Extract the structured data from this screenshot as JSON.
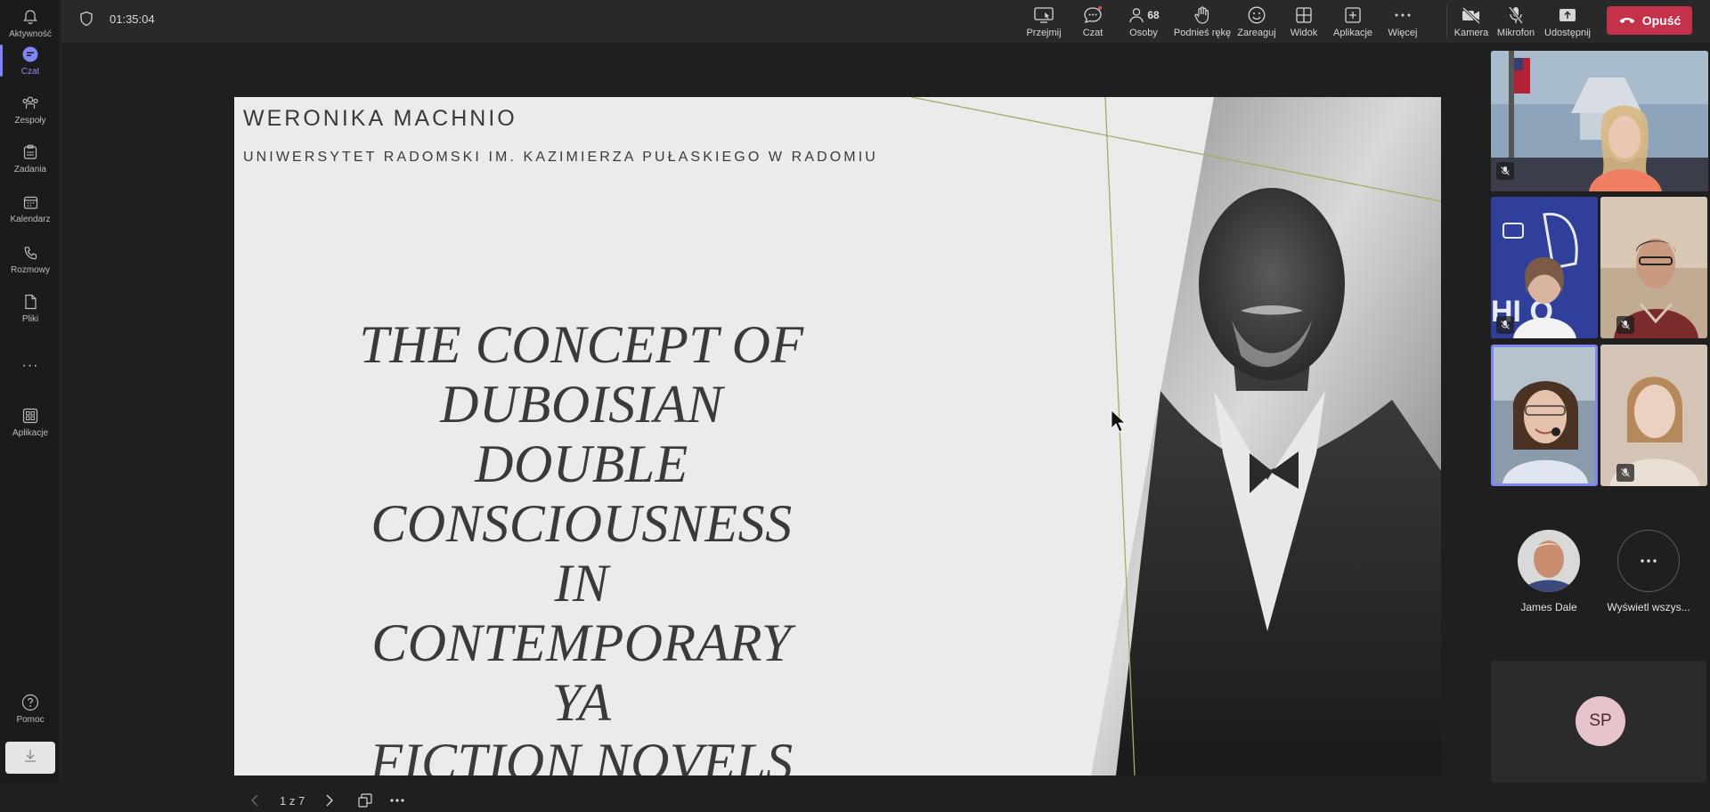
{
  "rail": {
    "items": [
      {
        "label": "Aktywność",
        "icon": "bell-icon"
      },
      {
        "label": "Czat",
        "icon": "chat-icon"
      },
      {
        "label": "Zespoły",
        "icon": "teams-icon"
      },
      {
        "label": "Zadania",
        "icon": "tasks-icon"
      },
      {
        "label": "Kalendarz",
        "icon": "calendar-icon"
      },
      {
        "label": "Rozmowy",
        "icon": "phone-icon"
      },
      {
        "label": "Pliki",
        "icon": "file-icon"
      },
      {
        "label": "Aplikacje",
        "icon": "apps-icon"
      },
      {
        "label": "Pomoc",
        "icon": "help-icon"
      }
    ],
    "more": "···"
  },
  "meeting": {
    "timer": "01:35:04",
    "toolbar": {
      "take_control": "Przejmij",
      "chat": "Czat",
      "people": "Osoby",
      "people_count": "68",
      "raise_hand": "Podnieś rękę",
      "react": "Zareaguj",
      "view": "Widok",
      "apps": "Aplikacje",
      "more": "Więcej",
      "camera": "Kamera",
      "microphone": "Mikrofon",
      "share": "Udostępnij",
      "leave": "Opuść"
    }
  },
  "slide": {
    "author": "WERONIKA MACHNIO",
    "affiliation": "UNIWERSYTET RADOMSKI IM. KAZIMIERZA PUŁASKIEGO W RADOMIU",
    "title_lines": [
      "THE CONCEPT OF",
      "DUBOISIAN DOUBLE",
      "CONSCIOUSNESS IN",
      "CONTEMPORARY YA",
      "FICTION NOVELS"
    ],
    "page_indicator": "1 z 7"
  },
  "participants": {
    "named": [
      {
        "name": "James Dale"
      }
    ],
    "show_all_label": "Wyświetl wszys...",
    "self_initials": "SP"
  },
  "colors": {
    "accent": "#7f85f5",
    "leave": "#c4314b",
    "slide_bg": "#ebebeb",
    "self_avatar": "#e7c4c9"
  }
}
